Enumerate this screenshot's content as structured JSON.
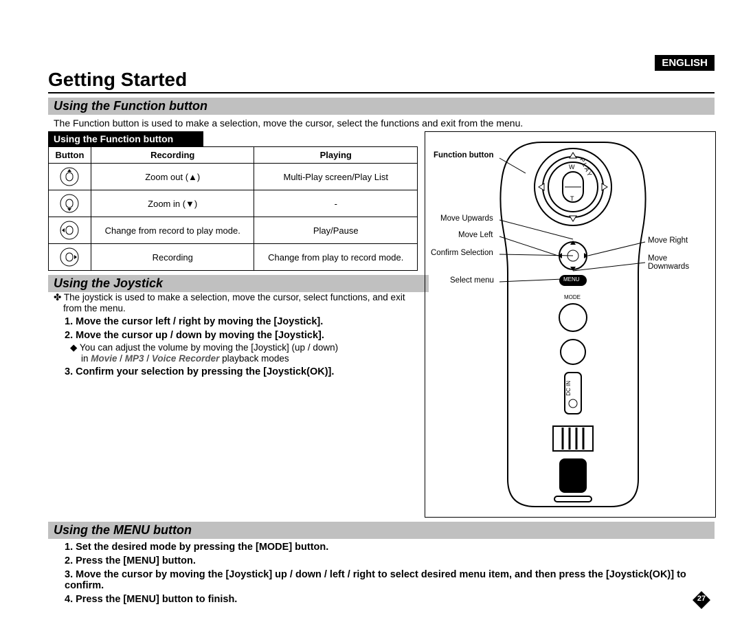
{
  "language_badge": "ENGLISH",
  "chapter_title": "Getting Started",
  "section1": {
    "title": "Using the Function button",
    "intro": "The Function button is used to make a selection, move the cursor, select the functions and exit from the menu.",
    "table_title": "Using the Function button",
    "headers": {
      "c1": "Button",
      "c2": "Recording",
      "c3": "Playing"
    },
    "rows": [
      {
        "rec": "Zoom out (▲)",
        "play": "Multi-Play screen/Play List"
      },
      {
        "rec": "Zoom in (▼)",
        "play": "-"
      },
      {
        "rec": "Change from record to play mode.",
        "play": "Play/Pause"
      },
      {
        "rec": "Recording",
        "play": "Change from play to record mode."
      }
    ]
  },
  "section2": {
    "title": "Using the Joystick",
    "bullet": "The joystick is used to make a selection, move the cursor, select functions, and exit from the menu.",
    "items": {
      "n1": "1.  Move the cursor left / right by moving the [Joystick].",
      "n2": "2.  Move the cursor up / down by moving the [Joystick].",
      "n2sub": "◆   You can adjust the volume by moving the [Joystick] (up / down)",
      "n2modes_prefix": "in ",
      "n2modes_movie": "Movie",
      "n2modes_sep": " / ",
      "n2modes_mp3": "MP3",
      "n2modes_voice": "Voice Recorder",
      "n2modes_suffix": " playback modes",
      "n3": "3.  Confirm your selection by pressing the [Joystick(OK)]."
    }
  },
  "section3": {
    "title": "Using the MENU button",
    "items": {
      "n1": "1.  Set the desired mode by pressing the [MODE] button.",
      "n2": "2.  Press the [MENU] button.",
      "n3": "3.  Move the cursor by moving the [Joystick] up / down / left / right to select desired menu item, and then press the [Joystick(OK)] to confirm.",
      "n4": "4.  Press the [MENU] button to finish."
    }
  },
  "diagram": {
    "function_button": "Function button",
    "move_upwards": "Move Upwards",
    "move_left": "Move Left",
    "confirm": "Confirm Selection",
    "select_menu": "Select menu",
    "move_right": "Move Right",
    "move_downwards": "Move Downwards",
    "menu": "MENU",
    "mode": "MODE",
    "dcin": "DC IN",
    "play_label": "PLAY",
    "w": "W",
    "t": "T"
  },
  "page_number": "27"
}
